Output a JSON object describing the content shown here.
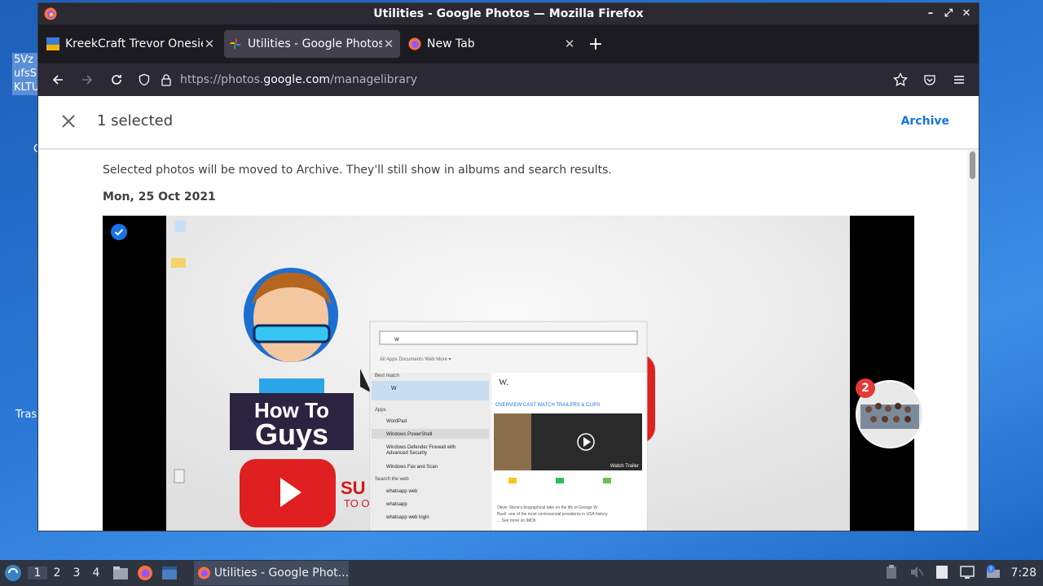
{
  "desktop": {
    "selected_text": "5Vz\nufsS\nKLTU",
    "c_label": "C",
    "trash_label": "Tras"
  },
  "window": {
    "title": "Utilities - Google Photos — Mozilla Firefox"
  },
  "tabs": [
    {
      "label": "KreekCraft Trevor Onesie",
      "active": false
    },
    {
      "label": "Utilities - Google Photos",
      "active": true
    },
    {
      "label": "New Tab",
      "active": false
    }
  ],
  "urlbar": {
    "prefix": "https://photos.",
    "domain": "google.com",
    "path": "/managelibrary"
  },
  "selection": {
    "count_label": "1 selected",
    "archive_label": "Archive",
    "info": "Selected photos will be moved to Archive. They'll still show in albums and search results.",
    "date": "Mon, 25 Oct 2021"
  },
  "photo": {
    "how_to_line1": "How To",
    "how_to_line2": "Guys",
    "sub_text": "SU",
    "to_text": "TO O",
    "search_query": "w",
    "result_title": "W.",
    "menu_items": [
      "Best match",
      "W",
      "Apps",
      "WordPad",
      "Windows PowerShell",
      "Windows Defender Firewall with Advanced Security",
      "Windows Fax and Scan",
      "Search the web",
      "whatsapp web",
      "whatsapp",
      "whatsapp web login"
    ],
    "tabs": [
      "All",
      "Apps",
      "Documents",
      "Web",
      "More"
    ],
    "detail_tabs": [
      "OVERVIEW",
      "CAST",
      "WATCH",
      "TRAILERS & CLIPS"
    ],
    "watch_trailer": "Watch Trailer"
  },
  "overlay": {
    "badge_count": "2"
  },
  "taskbar": {
    "workspaces": [
      "1",
      "2",
      "3",
      "4"
    ],
    "active_workspace": "1",
    "task_label": "Utilities - Google Phot...",
    "clock": "7:28"
  },
  "colors": {
    "accent_blue": "#1a73e8",
    "badge_red": "#e53935",
    "firefox_dark": "#2b2a33"
  }
}
